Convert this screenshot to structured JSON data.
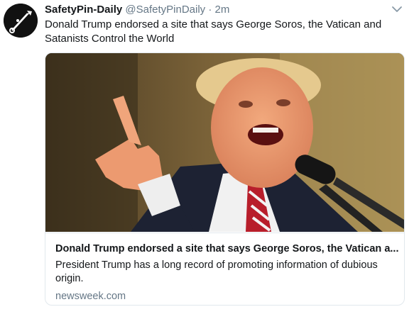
{
  "tweet": {
    "display_name": "SafetyPin-Daily",
    "handle": "@SafetyPinDaily",
    "separator": "·",
    "timestamp": "2m",
    "text": "Donald Trump endorsed a site that says George Soros, the Vatican and Satanists Control the World",
    "menu_icon": "chevron-down-icon",
    "avatar_icon": "safety-pin-logo"
  },
  "card": {
    "title": "Donald Trump endorsed a site that says George Soros, the Vatican a...",
    "description": "President Trump has a long record of promoting information of dubious origin.",
    "domain": "newsweek.com"
  },
  "colors": {
    "primary_text": "#14171a",
    "secondary_text": "#657786",
    "border": "#e1e8ed",
    "background": "#ffffff"
  }
}
